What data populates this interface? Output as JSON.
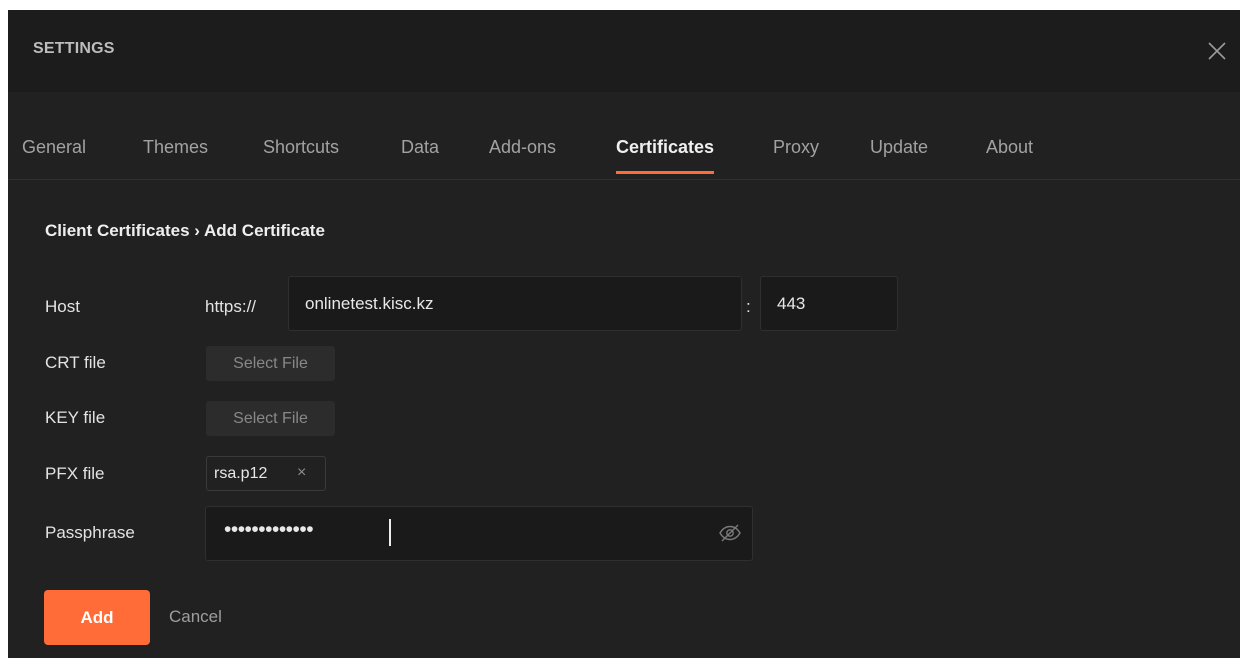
{
  "dialog": {
    "title": "SETTINGS",
    "close_icon": "close-icon"
  },
  "tabs": [
    {
      "label": "General",
      "active": false
    },
    {
      "label": "Themes",
      "active": false
    },
    {
      "label": "Shortcuts",
      "active": false
    },
    {
      "label": "Data",
      "active": false
    },
    {
      "label": "Add-ons",
      "active": false
    },
    {
      "label": "Certificates",
      "active": true
    },
    {
      "label": "Proxy",
      "active": false
    },
    {
      "label": "Update",
      "active": false
    },
    {
      "label": "About",
      "active": false
    }
  ],
  "breadcrumb": "Client Certificates › Add Certificate",
  "form": {
    "host": {
      "label": "Host",
      "prefix": "https://",
      "value": "onlinetest.kisc.kz",
      "separator": ":",
      "port": "443"
    },
    "crt": {
      "label": "CRT file",
      "button": "Select File"
    },
    "key": {
      "label": "KEY file",
      "button": "Select File"
    },
    "pfx": {
      "label": "PFX file",
      "file_name": "rsa.p12",
      "remove_glyph": "×"
    },
    "passphrase": {
      "label": "Passphrase",
      "masked_value": "•••••••••••••",
      "visibility_icon": "eye-slash-icon"
    }
  },
  "actions": {
    "add": "Add",
    "cancel": "Cancel"
  },
  "colors": {
    "accent": "#ff6c37",
    "background": "#212121",
    "header": "#1c1c1c",
    "input": "#1a1a1a"
  }
}
